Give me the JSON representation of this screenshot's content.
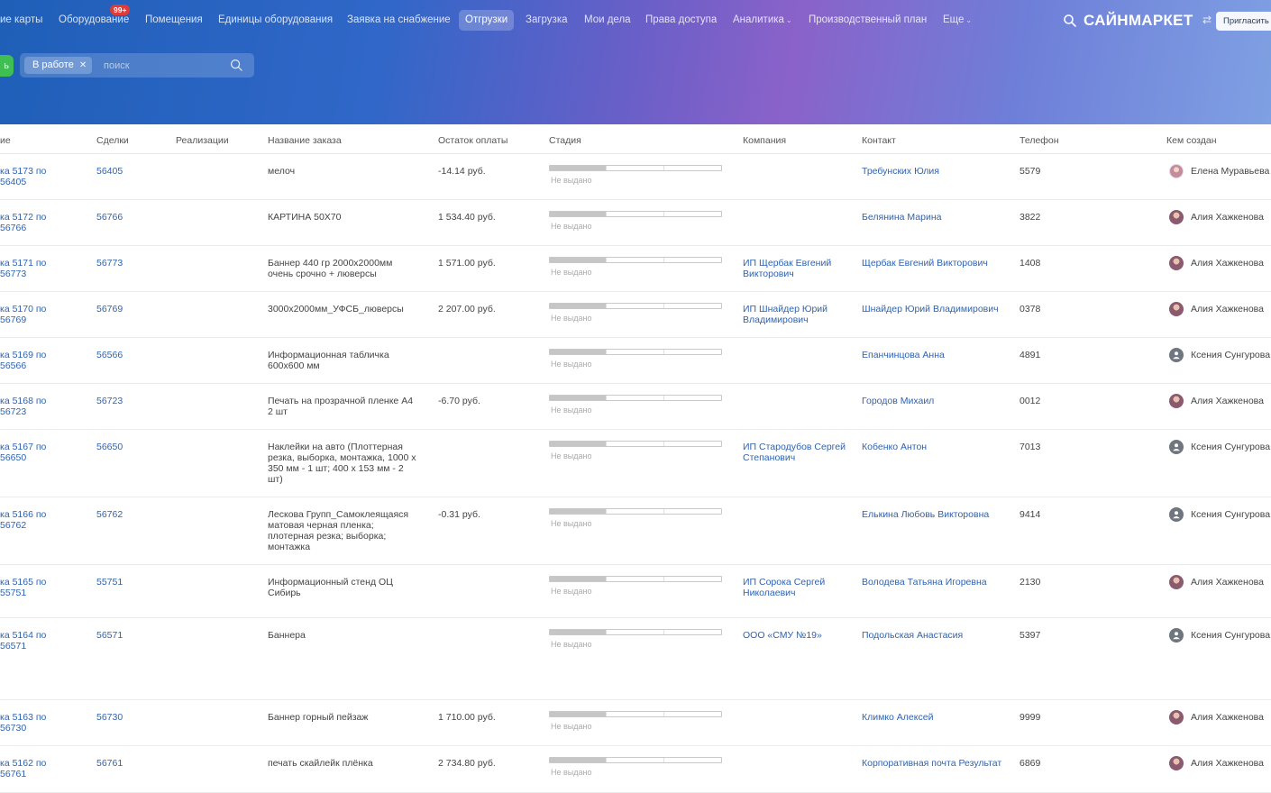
{
  "nav": {
    "items": [
      {
        "label": "ие карты",
        "active": false
      },
      {
        "label": "Оборудование",
        "active": false,
        "badge": "99+"
      },
      {
        "label": "Помещения",
        "active": false
      },
      {
        "label": "Единицы оборудования",
        "active": false
      },
      {
        "label": "Заявка на снабжение",
        "active": false
      },
      {
        "label": "Отгрузки",
        "active": true
      },
      {
        "label": "Загрузка",
        "active": false
      },
      {
        "label": "Мои дела",
        "active": false
      },
      {
        "label": "Права доступа",
        "active": false
      },
      {
        "label": "Аналитика",
        "active": false,
        "dropdown": true
      },
      {
        "label": "Производственный план",
        "active": false
      },
      {
        "label": "Еще",
        "active": false,
        "dropdown": true
      }
    ],
    "logo": "САЙНМАРКЕТ",
    "invite_label": "Пригласить"
  },
  "filter": {
    "green_button_label": "ь",
    "chip_label": "В работе",
    "search_placeholder": "поиск"
  },
  "table": {
    "headers": {
      "name": "ие",
      "deals": "Сделки",
      "realizations": "Реализации",
      "order_name": "Название заказа",
      "balance": "Остаток оплаты",
      "stage": "Стадия",
      "company": "Компания",
      "contact": "Контакт",
      "phone": "Телефон",
      "creator": "Кем создан"
    },
    "rows": [
      {
        "name": "ка 5173 по 56405",
        "deal": "56405",
        "order": "мелоч",
        "balance": "-14.14 руб.",
        "stage": "Не выдано",
        "company": "",
        "contact": "Требунских Юлия",
        "phone": "5579",
        "creator": "Елена Муравьева",
        "avatar": "photo2"
      },
      {
        "name": "ка 5172 по 56766",
        "deal": "56766",
        "order": "КАРТИНА 50Х70",
        "balance": "1 534.40 руб.",
        "stage": "Не выдано",
        "company": "",
        "contact": "Белянина Марина",
        "phone": "3822",
        "creator": "Алия Хажкенова",
        "avatar": "photo"
      },
      {
        "name": "ка 5171 по 56773",
        "deal": "56773",
        "order": "Баннер 440 гр 2000х2000мм очень срочно + люверсы",
        "balance": "1 571.00 руб.",
        "stage": "Не выдано",
        "company": "ИП Щербак Евгений Викторович",
        "contact": "Щербак Евгений Викторович",
        "phone": "1408",
        "creator": "Алия Хажкенова",
        "avatar": "photo"
      },
      {
        "name": "ка 5170 по 56769",
        "deal": "56769",
        "order": "3000х2000мм_УФСБ_люверсы",
        "balance": "2 207.00 руб.",
        "stage": "Не выдано",
        "company": "ИП Шнайдер Юрий Владимирович",
        "contact": "Шнайдер Юрий Владимирович",
        "phone": "0378",
        "creator": "Алия Хажкенова",
        "avatar": "photo"
      },
      {
        "name": "ка 5169 по 56566",
        "deal": "56566",
        "order": "Информационная табличка 600х600 мм",
        "balance": "",
        "stage": "Не выдано",
        "company": "",
        "contact": "Епанчинцова Анна",
        "phone": "4891",
        "creator": "Ксения Сунгурова",
        "avatar": "default"
      },
      {
        "name": "ка 5168 по 56723",
        "deal": "56723",
        "order": "Печать на прозрачной пленке А4 2 шт",
        "balance": "-6.70 руб.",
        "stage": "Не выдано",
        "company": "",
        "contact": "Городов Михаил",
        "phone": "0012",
        "creator": "Алия Хажкенова",
        "avatar": "photo"
      },
      {
        "name": "ка 5167 по 56650",
        "deal": "56650",
        "order": "Наклейки на авто (Плоттерная резка, выборка, монтажка, 1000 х 350 мм - 1 шт; 400 х 153 мм - 2 шт)",
        "balance": "",
        "stage": "Не выдано",
        "company": "ИП Стародубов Сергей Степанович",
        "contact": "Кобенко Антон",
        "phone": "7013",
        "creator": "Ксения Сунгурова",
        "avatar": "default"
      },
      {
        "name": "ка 5166 по 56762",
        "deal": "56762",
        "order": "Лескова Групп_Самоклеящаяся матовая черная пленка; плотерная резка; выборка; монтажка",
        "balance": "-0.31 руб.",
        "stage": "Не выдано",
        "company": "",
        "contact": "Елькина Любовь Викторовна",
        "phone": "9414",
        "creator": "Ксения Сунгурова",
        "avatar": "default"
      },
      {
        "name": "ка 5165 по 55751",
        "deal": "55751",
        "order": "Информационный стенд ОЦ Сибирь",
        "balance": "",
        "stage": "Не выдано",
        "company": "ИП Сорока Сергей Николаевич",
        "contact": "Володева Татьяна Игоревна",
        "phone": "2130",
        "creator": "Алия Хажкенова",
        "avatar": "photo"
      },
      {
        "name": "ка 5164 по 56571",
        "deal": "56571",
        "order": "Баннера",
        "balance": "",
        "stage": "Не выдано",
        "company": "ООО «СМУ №19»",
        "contact": "Подольская Анастасия",
        "phone": "5397",
        "creator": "Ксения Сунгурова",
        "avatar": "default"
      },
      {
        "name": "ка 5163 по 56730",
        "deal": "56730",
        "order": "Баннер горный пейзаж",
        "balance": "1 710.00 руб.",
        "stage": "Не выдано",
        "company": "",
        "contact": "Климко Алексей",
        "phone": "9999",
        "creator": "Алия Хажкенова",
        "avatar": "photo"
      },
      {
        "name": "ка 5162 по 56761",
        "deal": "56761",
        "order": "печать скайлейк плёнка",
        "balance": "2 734.80 руб.",
        "stage": "Не выдано",
        "company": "",
        "contact": "Корпоративная почта Результат",
        "phone": "6869",
        "creator": "Алия Хажкенова",
        "avatar": "photo"
      }
    ]
  }
}
